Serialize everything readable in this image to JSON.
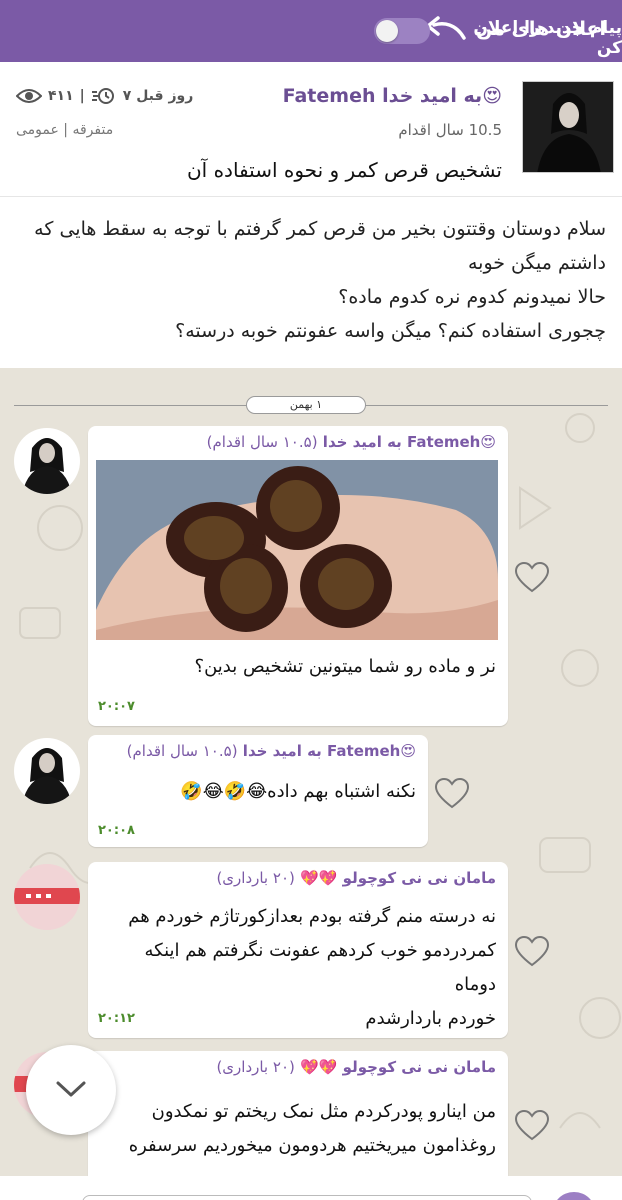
{
  "topbar": {
    "back_label": "اعلان های من",
    "notify_label": "پیام جدید را اعلان کن",
    "notify_enabled": false
  },
  "post": {
    "author": "😍به امید خدا Fatemeh",
    "stage": "10.5 سال اقدام",
    "time_ago": "۷ روز قبل",
    "views": "۴۱۱",
    "category": "متفرقه | عمومی",
    "title": "تشخیص قرص کمر و نحوه استفاده آن",
    "body_lines": [
      "سلام دوستان وقتتون بخیر من قرص کمر گرفتم با توجه به سقط هایی که",
      "داشتم میگن خوبه",
      "حالا نمیدونم کدوم نره کدوم ماده؟",
      "چجوری استفاده کنم؟ میگن واسه عفونتم خوبه درسته؟"
    ]
  },
  "chat": {
    "date_label": "۱ بهمن",
    "messages": [
      {
        "name": "😍Fatemeh به امید خدا",
        "stage": "(۱۰.۵ سال اقدام)",
        "text_lines": [
          "نر و ماده رو شما میتونین تشخیص بدین؟"
        ],
        "time": "۲۰:۰۷",
        "has_image": true
      },
      {
        "name": "😍Fatemeh به امید خدا",
        "stage": "(۱۰.۵ سال اقدام)",
        "text_lines": [
          "نکنه اشتباه بهم داده😂🤣😂🤣"
        ],
        "time": "۲۰:۰۸"
      },
      {
        "name": "مامان نی نی کوچولو 💖💖",
        "stage": "(۲۰ بارداری)",
        "text_lines": [
          "نه درسته منم گرفته بودم بعدازکورتاژم خوردم هم",
          "کمردردمو خوب کردهم عفونت نگرفتم هم اینکه دوماه",
          "خوردم باردارشدم"
        ],
        "time": "۲۰:۱۲"
      },
      {
        "name": "مامان نی نی کوچولو 💖💖",
        "stage": "(۲۰ بارداری)",
        "text_lines": [
          "من اینارو پودرکردم مثل نمک ریختم تو نمکدون",
          "روغذامون میریختیم هردومون میخوردیم سرسفره"
        ]
      }
    ]
  }
}
